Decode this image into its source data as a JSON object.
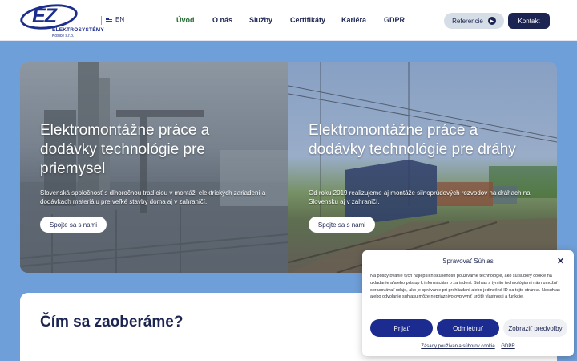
{
  "header": {
    "logo": {
      "name": "ELEKTROSYSTÉMY",
      "subtitle": "Košice s.r.o.",
      "mark": "EZ"
    },
    "language": "EN",
    "nav": [
      "Úvod",
      "O nás",
      "Služby",
      "Certifikáty",
      "Kariéra",
      "GDPR"
    ],
    "active_nav": "Úvod",
    "references_label": "Referencie",
    "contact_label": "Kontakt"
  },
  "hero": {
    "left": {
      "title": "Elektromontážne práce a dodávky technológie pre priemysel",
      "text": "Slovenská spoločnosť s dlhoročnou tradíciou v montáži elektrických zariadení a dodávkach materiálu pre veľké stavby doma aj v zahraničí.",
      "cta": "Spojte sa s nami"
    },
    "right": {
      "title": "Elektromontážne práce a dodávky technológie pre dráhy",
      "text": "Od roku 2019 realizujeme aj montáže silnoprúdových rozvodov na dráhach na Slovensku aj v zahraničí.",
      "cta": "Spojte sa s nami"
    }
  },
  "section": {
    "title": "Čím sa zaoberáme?"
  },
  "cookie": {
    "title": "Spravovať Súhlas",
    "text": "Na poskytovanie tých najlepších skúseností používame technológie, ako sú súbory cookie na ukladanie a/alebo prístup k informáciám o zariadení. Súhlas s týmito technológiami nám umožní spracovávať údaje, ako je správanie pri prehliadaní alebo jedinečné ID na tejto stránke. Nesúhlas alebo odvolanie súhlasu môže nepriaznivo ovplyvniť určité vlastnosti a funkcie.",
    "accept_label": "Prijať",
    "deny_label": "Odmietnuť",
    "prefs_label": "Zobraziť predvoľby",
    "policy_link": "Zásady používania súborov cookie",
    "gdpr_link": "GDPR"
  },
  "colors": {
    "brand": "#1c2452",
    "accent_green": "#1f6a2f",
    "background": "#6f9fd8",
    "button_blue": "#1c2b8f"
  },
  "icons": {
    "references_arrow": "arrow-right-circle-icon",
    "close": "close-icon",
    "flag": "uk-flag-icon"
  }
}
